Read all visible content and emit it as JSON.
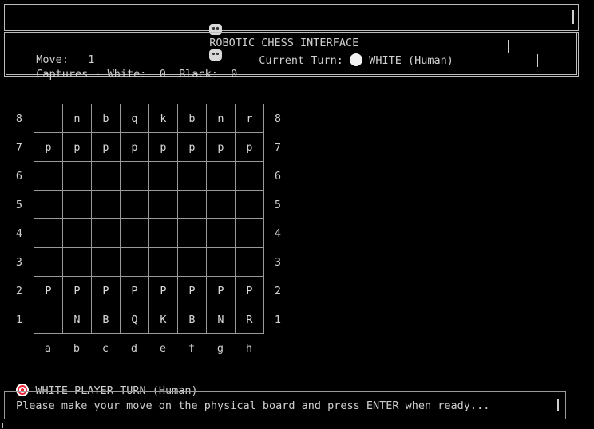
{
  "header": {
    "title": "ROBOTIC CHESS INTERFACE",
    "icon": "robot-icon"
  },
  "status": {
    "move_label": "Move:",
    "move_value": "1",
    "turn_label": "Current Turn:",
    "turn_icon": "white-circle-icon",
    "turn_value": "WHITE (Human)",
    "captures_label": "Captures - White:",
    "captures_white": "0",
    "captures_black_label": "Black:",
    "captures_black": "0"
  },
  "board": {
    "ranks": [
      "8",
      "7",
      "6",
      "5",
      "4",
      "3",
      "2",
      "1"
    ],
    "files": [
      "a",
      "b",
      "c",
      "d",
      "e",
      "f",
      "g",
      "h"
    ],
    "rows": [
      [
        "",
        "n",
        "b",
        "q",
        "k",
        "b",
        "n",
        "r"
      ],
      [
        "p",
        "p",
        "p",
        "p",
        "p",
        "p",
        "p",
        "p"
      ],
      [
        "",
        "",
        "",
        "",
        "",
        "",
        "",
        ""
      ],
      [
        "",
        "",
        "",
        "",
        "",
        "",
        "",
        ""
      ],
      [
        "",
        "",
        "",
        "",
        "",
        "",
        "",
        ""
      ],
      [
        "",
        "",
        "",
        "",
        "",
        "",
        "",
        ""
      ],
      [
        "P",
        "P",
        "P",
        "P",
        "P",
        "P",
        "P",
        "P"
      ],
      [
        "",
        "N",
        "B",
        "Q",
        "K",
        "B",
        "N",
        "R"
      ]
    ]
  },
  "turn_banner": {
    "icon": "target-icon",
    "text": "WHITE PLAYER TURN (Human)"
  },
  "prompt": {
    "text": "Please make your move on the physical board and press ENTER when ready..."
  }
}
